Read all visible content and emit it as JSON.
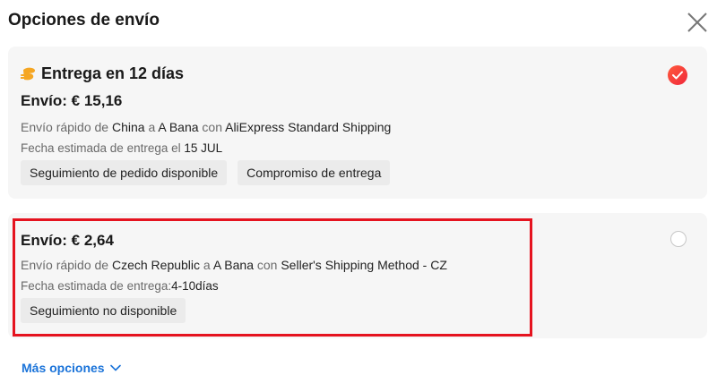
{
  "dialog": {
    "title": "Opciones de envío",
    "close_icon": "close-icon"
  },
  "options": [
    {
      "selected": true,
      "badge_icon": "delivery-promise-icon",
      "headline": "Entrega en 12 días",
      "price": "Envío: € 15,16",
      "route": {
        "prefix": "Envío rápido de ",
        "origin": "China",
        "to_word": " a ",
        "destination": "A Bana",
        "with_word": " con ",
        "method": "AliExpress Standard Shipping"
      },
      "eta": {
        "label": "Fecha estimada de entrega el ",
        "value": "15 JUL"
      },
      "tags": [
        "Seguimiento de pedido disponible",
        "Compromiso de entrega"
      ]
    },
    {
      "selected": false,
      "price": "Envío: € 2,64",
      "route": {
        "prefix": "Envío rápido de ",
        "origin": "Czech Republic",
        "to_word": " a ",
        "destination": "A Bana",
        "with_word": " con ",
        "method": "Seller's Shipping Method - CZ"
      },
      "eta": {
        "label": "Fecha estimada de entrega:",
        "value": "4-10días"
      },
      "tags": [
        "Seguimiento no disponible"
      ]
    }
  ],
  "footer": {
    "more_label": "Más opciones",
    "more_icon": "chevron-down-icon"
  },
  "colors": {
    "accent_red": "#f0283b",
    "highlight_border": "#e5131f",
    "link_blue": "#1a73d9",
    "badge_orange": "#f5a623"
  }
}
